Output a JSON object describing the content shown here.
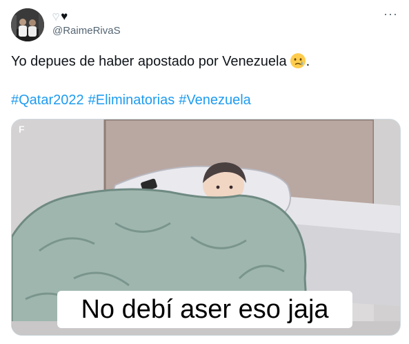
{
  "author": {
    "handle": "@RaimeRivaS",
    "name_icons": [
      "white-heart-icon",
      "black-heart-icon"
    ]
  },
  "tweet": {
    "text": "Yo depues de haber apostado por Venezuela",
    "trailing_text": ".",
    "emoji": "crying-face-emoji",
    "hashtags": [
      "#Qatar2022",
      "#Eliminatorias",
      "#Venezuela"
    ]
  },
  "media": {
    "watermark": "F",
    "caption": "No debí aser eso jaja"
  },
  "colors": {
    "link": "#1d9bf0",
    "text": "#0f1419",
    "secondary": "#536471"
  },
  "menu_icon": "more-dots-icon"
}
